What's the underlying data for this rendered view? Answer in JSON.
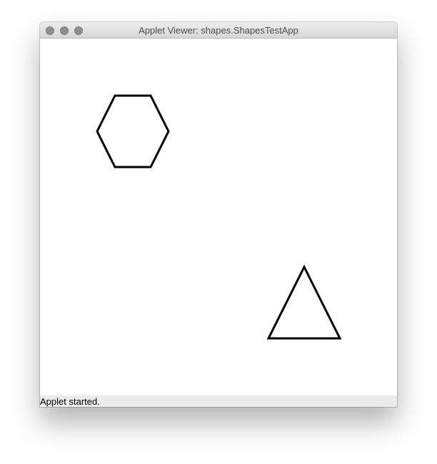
{
  "window": {
    "title": "Applet Viewer: shapes.ShapesTestApp",
    "controls": {
      "close_icon": "close-icon",
      "minimize_icon": "minimize-icon",
      "zoom_icon": "zoom-icon",
      "control_color": "#8e8e8e"
    }
  },
  "canvas": {
    "shapes": [
      {
        "type": "hexagon",
        "name": "hexagon-shape",
        "stroke_color": "#000000"
      },
      {
        "type": "triangle",
        "name": "triangle-shape",
        "stroke_color": "#000000"
      }
    ]
  },
  "status": {
    "text": "Applet started."
  }
}
